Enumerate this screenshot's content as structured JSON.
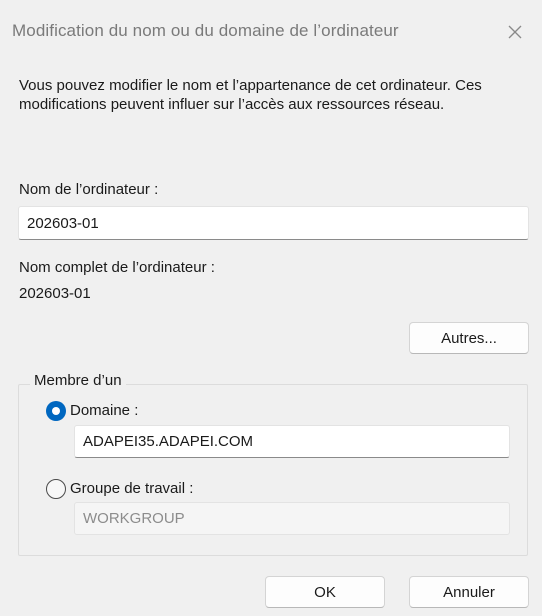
{
  "window": {
    "title": "Modification du nom ou du domaine de l’ordinateur",
    "close_icon": "close-icon"
  },
  "description": "Vous pouvez modifier le nom et l’appartenance de cet ordinateur. Ces modifications peuvent influer sur l’accès aux ressources réseau.",
  "computer_name": {
    "label": "Nom de l’ordinateur :",
    "value": "202603-01"
  },
  "full_name": {
    "label": "Nom complet de l’ordinateur :",
    "value": "202603-01"
  },
  "more_button": "Autres...",
  "member_of": {
    "legend": "Membre d’un",
    "domain": {
      "label": "Domaine :",
      "selected": true,
      "value": "ADAPEI35.ADAPEI.COM"
    },
    "workgroup": {
      "label": "Groupe de travail :",
      "selected": false,
      "value": "WORKGROUP"
    }
  },
  "footer": {
    "ok_label": "OK",
    "cancel_label": "Annuler"
  },
  "colors": {
    "accent": "#0067c0",
    "background": "#f0f0f0",
    "title_text": "#7a7a7a"
  }
}
